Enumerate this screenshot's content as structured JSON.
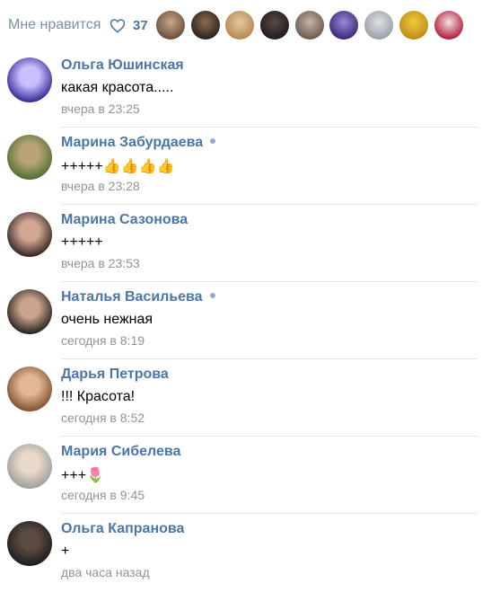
{
  "likes": {
    "label": "Мне нравится",
    "count": "37",
    "avatars": [
      {
        "colors": [
          "#6b4e3d",
          "#c9a889"
        ]
      },
      {
        "colors": [
          "#2a2320",
          "#8e6a4f"
        ]
      },
      {
        "colors": [
          "#b6884f",
          "#e3c9a2"
        ]
      },
      {
        "colors": [
          "#1f1d1d",
          "#5a4a45"
        ]
      },
      {
        "colors": [
          "#6a5a52",
          "#c6b3a2"
        ]
      },
      {
        "colors": [
          "#3b2a78",
          "#9b86d8"
        ]
      },
      {
        "colors": [
          "#9aa0a8",
          "#dfe2e6"
        ]
      },
      {
        "colors": [
          "#c08a1a",
          "#f0cb3d"
        ]
      },
      {
        "colors": [
          "#b01c3a",
          "#f2e3e6"
        ]
      }
    ]
  },
  "comments": [
    {
      "author": "Ольга Юшинская",
      "online": false,
      "text": "какая красота.....",
      "time": "вчера в 23:25",
      "avatar": [
        "#2c1f8e",
        "#c9c0ff"
      ]
    },
    {
      "author": "Марина Забурдаева",
      "online": true,
      "text": "+++++👍👍👍👍",
      "time": "вчера в 23:28",
      "avatar": [
        "#4b6b2e",
        "#b9a47a"
      ]
    },
    {
      "author": "Марина Сазонова",
      "online": false,
      "text": "+++++",
      "time": "вчера в 23:53",
      "avatar": [
        "#2a1d1a",
        "#d2a694"
      ]
    },
    {
      "author": "Наталья Васильева",
      "online": true,
      "text": "очень нежная",
      "time": "сегодня в 8:19",
      "avatar": [
        "#1d1816",
        "#c9a38e"
      ]
    },
    {
      "author": "Дарья Петрова",
      "online": false,
      "text": "!!! Красота!",
      "time": "сегодня в 8:52",
      "avatar": [
        "#7a4a2a",
        "#e2b795"
      ]
    },
    {
      "author": "Мария Сибелева",
      "online": false,
      "text": "+++🌷",
      "time": "сегодня в 9:45",
      "avatar": [
        "#9a9a9a",
        "#e8d9c8"
      ]
    },
    {
      "author": "Ольга Капранова",
      "online": false,
      "text": "+",
      "time": "два часа назад",
      "avatar": [
        "#1a1a1a",
        "#5a4a40"
      ]
    }
  ]
}
